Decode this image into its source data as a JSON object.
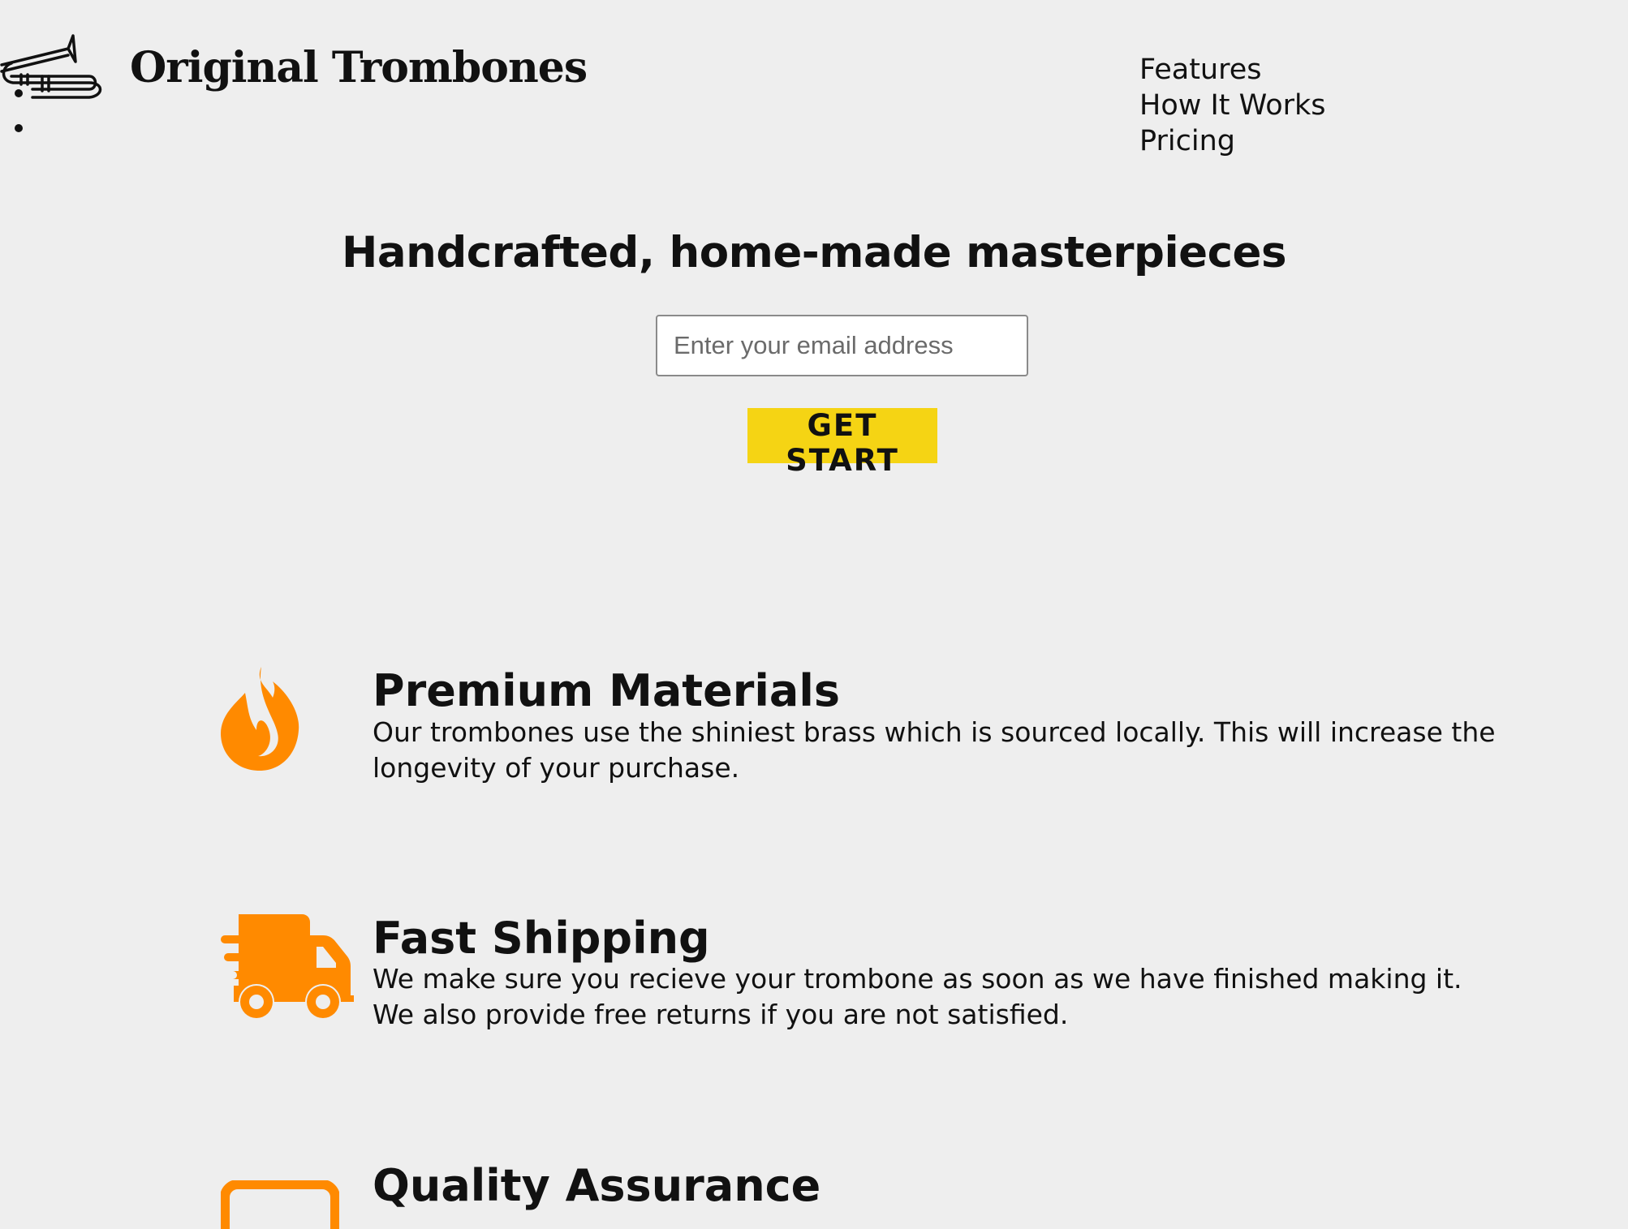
{
  "header": {
    "brand": "Original Trombones",
    "nav": [
      {
        "label": "Features"
      },
      {
        "label": "How It Works"
      },
      {
        "label": "Pricing"
      }
    ]
  },
  "hero": {
    "title": "Handcrafted, home-made masterpieces",
    "email_placeholder": "Enter your email address",
    "email_value": "",
    "cta_label": "GET START"
  },
  "features": [
    {
      "icon": "fire-icon",
      "title": "Premium Materials",
      "description": "Our trombones use the shiniest brass which is sourced locally. This will increase the longevity of your purchase."
    },
    {
      "icon": "truck-icon",
      "title": "Fast Shipping",
      "description": "We make sure you recieve your trombone as soon as we have finished making it. We also provide free returns if you are not satisfied."
    },
    {
      "icon": "battery-icon",
      "title": "Quality Assurance",
      "description": ""
    }
  ],
  "colors": {
    "background": "#eeeeee",
    "accent_yellow": "#f5d414",
    "icon_orange": "#ff8a00",
    "text": "#111111"
  }
}
